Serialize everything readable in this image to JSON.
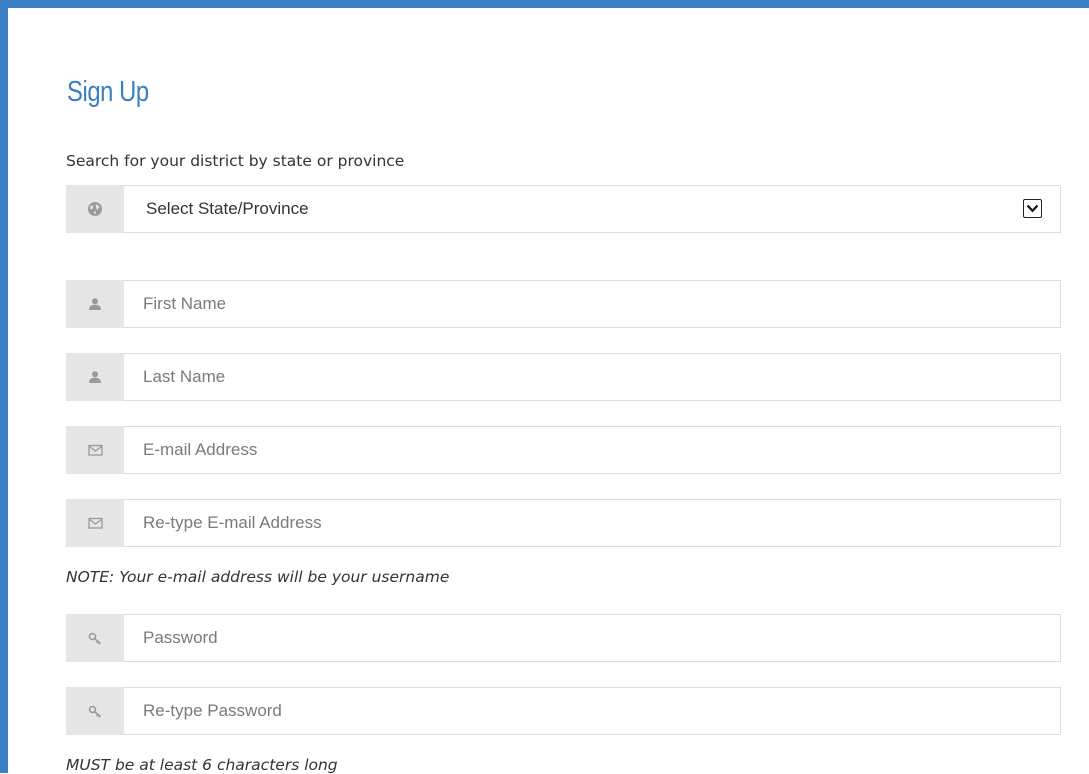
{
  "form": {
    "title": "Sign Up",
    "search_label": "Search for your district by state or province",
    "state_select": {
      "selected_value": "Select State/Province",
      "icon": "globe-icon"
    },
    "first_name": {
      "placeholder": "First Name",
      "icon": "user-icon"
    },
    "last_name": {
      "placeholder": "Last Name",
      "icon": "user-icon"
    },
    "email": {
      "placeholder": "E-mail Address",
      "icon": "envelope-icon"
    },
    "email_confirm": {
      "placeholder": "Re-type E-mail Address",
      "icon": "envelope-icon"
    },
    "email_note": "NOTE: Your e-mail address will be your username",
    "password": {
      "placeholder": "Password",
      "icon": "key-icon"
    },
    "password_confirm": {
      "placeholder": "Re-type Password",
      "icon": "key-icon"
    },
    "password_note": "MUST be at least 6 characters long"
  },
  "colors": {
    "accent": "#3b7fc4",
    "title": "#3a80c1",
    "addon_bg": "#e6e6e6",
    "border": "#dcdcdc",
    "placeholder": "#7a7a7a"
  }
}
